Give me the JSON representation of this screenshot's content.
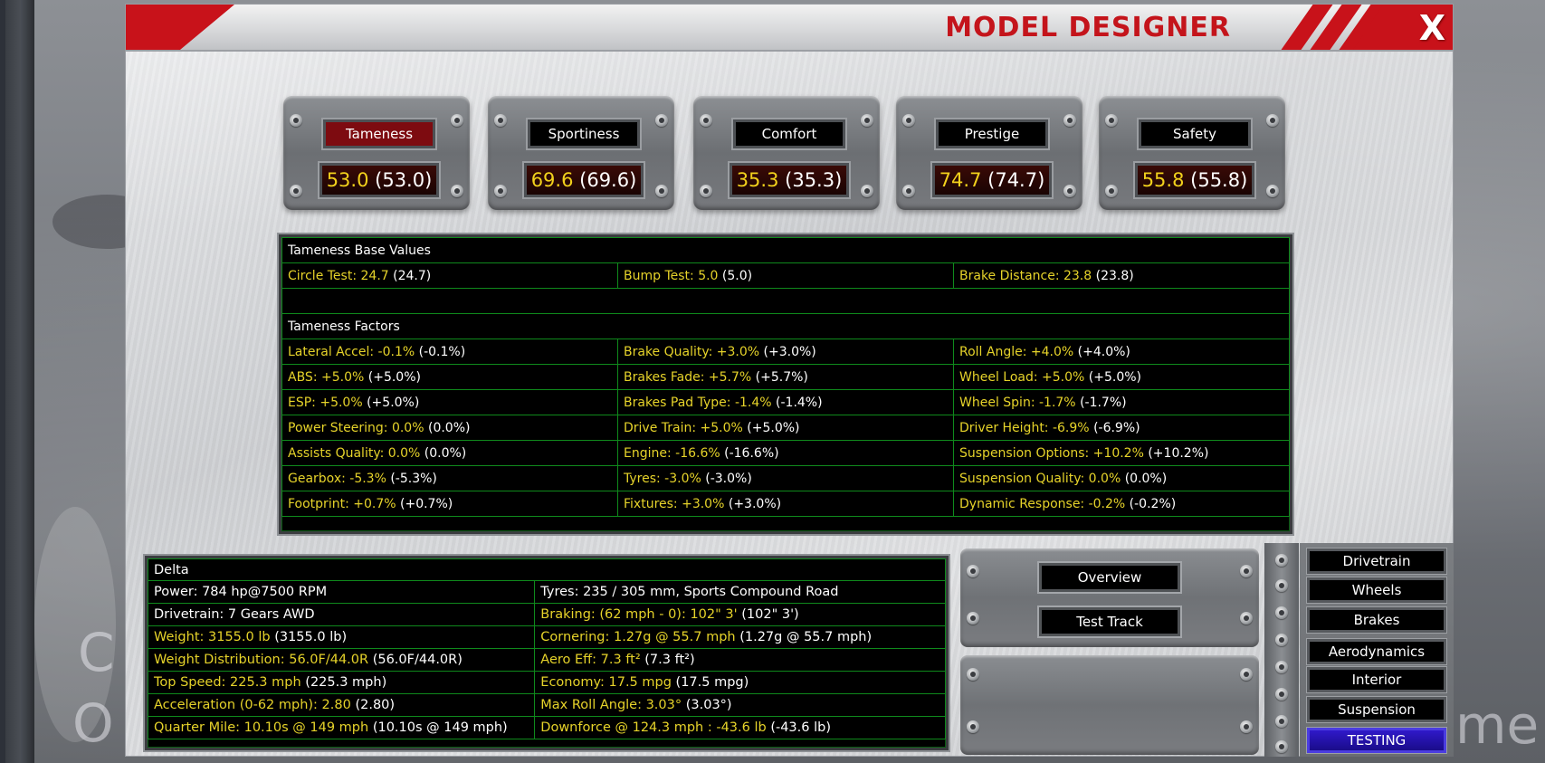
{
  "window": {
    "title": "MODEL DESIGNER",
    "close_label": "X"
  },
  "background": {
    "ghost_left_1": "C",
    "ghost_left_2": "O",
    "ghost_right": "me"
  },
  "ratings": [
    {
      "label": "Tameness",
      "value": "53.0",
      "paren": "(53.0)",
      "active": true
    },
    {
      "label": "Sportiness",
      "value": "69.6",
      "paren": "(69.6)"
    },
    {
      "label": "Comfort",
      "value": "35.3",
      "paren": "(35.3)"
    },
    {
      "label": "Prestige",
      "value": "74.7",
      "paren": "(74.7)"
    },
    {
      "label": "Safety",
      "value": "55.8",
      "paren": "(55.8)"
    }
  ],
  "tameness": {
    "base_header": "Tameness Base Values",
    "base": [
      {
        "label": "Circle Test: 24.7",
        "paren": "(24.7)"
      },
      {
        "label": "Bump Test: 5.0",
        "paren": "(5.0)"
      },
      {
        "label": "Brake Distance: 23.8",
        "paren": "(23.8)"
      }
    ],
    "factors_header": "Tameness Factors",
    "factors": [
      [
        {
          "label": "Lateral Accel: -0.1%",
          "paren": "(-0.1%)"
        },
        {
          "label": "Brake Quality: +3.0%",
          "paren": "(+3.0%)"
        },
        {
          "label": "Roll Angle: +4.0%",
          "paren": "(+4.0%)"
        }
      ],
      [
        {
          "label": "ABS: +5.0%",
          "paren": "(+5.0%)"
        },
        {
          "label": "Brakes Fade: +5.7%",
          "paren": "(+5.7%)"
        },
        {
          "label": "Wheel Load: +5.0%",
          "paren": "(+5.0%)"
        }
      ],
      [
        {
          "label": "ESP: +5.0%",
          "paren": "(+5.0%)"
        },
        {
          "label": "Brakes Pad Type: -1.4%",
          "paren": "(-1.4%)"
        },
        {
          "label": "Wheel Spin: -1.7%",
          "paren": "(-1.7%)"
        }
      ],
      [
        {
          "label": "Power Steering: 0.0%",
          "paren": "(0.0%)"
        },
        {
          "label": "Drive Train: +5.0%",
          "paren": "(+5.0%)"
        },
        {
          "label": "Driver Height: -6.9%",
          "paren": "(-6.9%)"
        }
      ],
      [
        {
          "label": "Assists Quality: 0.0%",
          "paren": "(0.0%)"
        },
        {
          "label": "Engine: -16.6%",
          "paren": "(-16.6%)"
        },
        {
          "label": "Suspension Options: +10.2%",
          "paren": "(+10.2%)"
        }
      ],
      [
        {
          "label": "Gearbox: -5.3%",
          "paren": "(-5.3%)"
        },
        {
          "label": "Tyres: -3.0%",
          "paren": "(-3.0%)"
        },
        {
          "label": "Suspension Quality: 0.0%",
          "paren": "(0.0%)"
        }
      ],
      [
        {
          "label": "Footprint: +0.7%",
          "paren": "(+0.7%)"
        },
        {
          "label": "Fixtures: +3.0%",
          "paren": "(+3.0%)"
        },
        {
          "label": "Dynamic Response: -0.2%",
          "paren": "(-0.2%)"
        }
      ]
    ]
  },
  "delta": {
    "header": "Delta",
    "rows": [
      [
        {
          "label": "Power: 784 hp@7500 RPM",
          "paren": "",
          "white": true
        },
        {
          "label": "Tyres: 235 / 305 mm, Sports Compound Road",
          "paren": "",
          "white": true
        }
      ],
      [
        {
          "label": "Drivetrain: 7 Gears AWD",
          "paren": "",
          "white": true
        },
        {
          "label": "Braking: (62 mph - 0): 102\" 3'",
          "paren": "(102\" 3')"
        }
      ],
      [
        {
          "label": "Weight: 3155.0 lb",
          "paren": "(3155.0 lb)"
        },
        {
          "label": "Cornering: 1.27g @ 55.7 mph",
          "paren": "(1.27g @ 55.7 mph)"
        }
      ],
      [
        {
          "label": "Weight Distribution: 56.0F/44.0R",
          "paren": "(56.0F/44.0R)"
        },
        {
          "label": "Aero Eff: 7.3 ft²",
          "paren": "(7.3 ft²)"
        }
      ],
      [
        {
          "label": "Top Speed: 225.3 mph",
          "paren": "(225.3 mph)"
        },
        {
          "label": "Economy: 17.5 mpg",
          "paren": "(17.5 mpg)"
        }
      ],
      [
        {
          "label": "Acceleration (0-62 mph): 2.80",
          "paren": "(2.80)"
        },
        {
          "label": "Max Roll Angle: 3.03°",
          "paren": "(3.03°)"
        }
      ],
      [
        {
          "label": "Quarter Mile: 10.10s @ 149 mph",
          "paren": "(10.10s @ 149 mph)"
        },
        {
          "label": "Downforce @ 124.3 mph : -43.6 lb",
          "paren": "(-43.6 lb)"
        }
      ]
    ]
  },
  "actions": {
    "overview": "Overview",
    "test_track": "Test Track"
  },
  "menu": [
    "Drivetrain",
    "Wheels",
    "Brakes",
    "Aerodynamics",
    "Interior",
    "Suspension",
    "TESTING"
  ],
  "colors": {
    "accent_red": "#c8121a",
    "value_yellow": "#f2d11c",
    "grid_green": "#0f8a1c",
    "active_blue": "#3019c9"
  }
}
